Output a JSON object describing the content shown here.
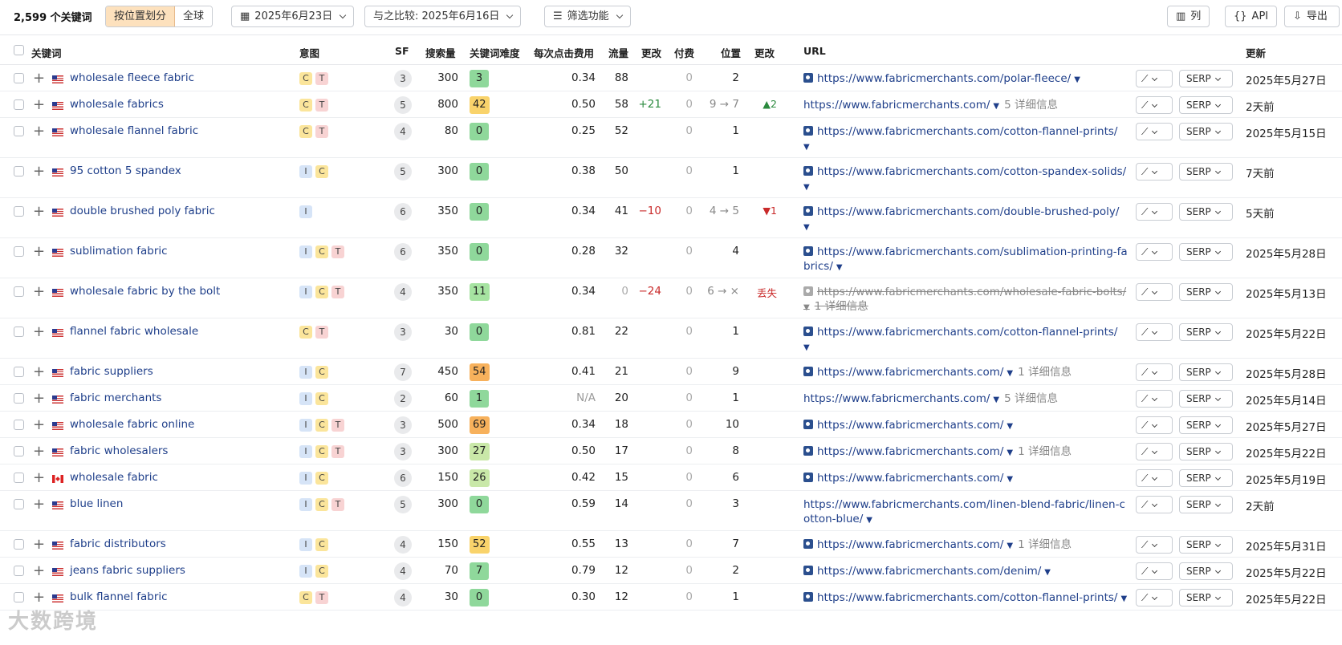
{
  "toolbar": {
    "count": "2,599 个关键词",
    "seg_by_position": "按位置划分",
    "seg_global": "全球",
    "date": "2025年6月23日",
    "compare": "与之比较:  2025年6月16日",
    "filters": "筛选功能",
    "view_list": "列",
    "api": "API",
    "export": "导出"
  },
  "columns": {
    "keyword": "关键词",
    "intent": "意图",
    "sf": "SF",
    "volume": "搜索量",
    "kd": "关键词难度",
    "cpc": "每次点击费用",
    "traffic": "流量",
    "change": "更改",
    "paid": "付费",
    "position": "位置",
    "pos_change": "更改",
    "url": "URL",
    "updated": "更新"
  },
  "colors": {
    "kd_green": "#a6e3a1",
    "kd_lightgreen": "#c9e8a8",
    "kd_yellow": "#f9d36b",
    "kd_orange": "#f7b15c",
    "up": "#2b8a3e",
    "down": "#c92a2a"
  },
  "rows": [
    {
      "kw": "wholesale fleece fabric",
      "flag": "us",
      "intents": [
        "C",
        "T"
      ],
      "sf": "3",
      "vol": "300",
      "kd": "3",
      "kdc": "#8fd89b",
      "cpc": "0.34",
      "tr": "88",
      "chg": "",
      "chgc": "",
      "paid": "0",
      "pos": "2",
      "pchg": "",
      "pchgc": "",
      "url1": "https://www.fabricmerchants.com/polar-fleece/",
      "url2": "",
      "det": "",
      "pic": true,
      "lost": false,
      "upd": "2025年5月27日",
      "h": 33
    },
    {
      "kw": "wholesale fabrics",
      "flag": "us",
      "intents": [
        "C",
        "T"
      ],
      "sf": "5",
      "vol": "800",
      "kd": "42",
      "kdc": "#f9d36b",
      "cpc": "0.50",
      "tr": "58",
      "chg": "+21",
      "chgc": "#2b8a3e",
      "paid": "0",
      "pos": "9 → 7",
      "pchg": "▲2",
      "pchgc": "#2b8a3e",
      "url1": "https://www.fabricmerchants.com/",
      "url2": "",
      "det": "5 详细信息",
      "pic": false,
      "lost": false,
      "upd": "2天前",
      "h": 33
    },
    {
      "kw": "wholesale flannel fabric",
      "flag": "us",
      "intents": [
        "C",
        "T"
      ],
      "sf": "4",
      "vol": "80",
      "kd": "0",
      "kdc": "#8fd89b",
      "cpc": "0.25",
      "tr": "52",
      "chg": "",
      "chgc": "",
      "paid": "0",
      "pos": "1",
      "pchg": "",
      "pchgc": "",
      "url1": "https://www.fabricmerchants.com/cotton-flannel-prints/",
      "url2": " ",
      "det": "",
      "pic": true,
      "lost": false,
      "upd": "2025年5月15日",
      "h": 50
    },
    {
      "kw": "95 cotton 5 spandex",
      "flag": "us",
      "intents": [
        "I",
        "C"
      ],
      "sf": "5",
      "vol": "300",
      "kd": "0",
      "kdc": "#8fd89b",
      "cpc": "0.38",
      "tr": "50",
      "chg": "",
      "chgc": "",
      "paid": "0",
      "pos": "1",
      "pchg": "",
      "pchgc": "",
      "url1": "https://www.fabricmerchants.com/cotton-spandex-solids/",
      "url2": " ",
      "det": "",
      "pic": true,
      "lost": false,
      "upd": "7天前",
      "h": 50
    },
    {
      "kw": "double brushed poly fabric",
      "flag": "us",
      "intents": [
        "I"
      ],
      "sf": "6",
      "vol": "350",
      "kd": "0",
      "kdc": "#8fd89b",
      "cpc": "0.34",
      "tr": "41",
      "chg": "−10",
      "chgc": "#c92a2a",
      "paid": "0",
      "pos": "4 → 5",
      "pchg": "▼1",
      "pchgc": "#c92a2a",
      "url1": "https://www.fabricmerchants.com/double-brushed-poly/",
      "url2": " ",
      "det": "",
      "pic": true,
      "lost": false,
      "upd": "5天前",
      "h": 50
    },
    {
      "kw": "sublimation fabric",
      "flag": "us",
      "intents": [
        "I",
        "C",
        "T"
      ],
      "sf": "6",
      "vol": "350",
      "kd": "0",
      "kdc": "#8fd89b",
      "cpc": "0.28",
      "tr": "32",
      "chg": "",
      "chgc": "",
      "paid": "0",
      "pos": "4",
      "pchg": "",
      "pchgc": "",
      "url1": "https://www.fabricmerchants.com/sublimation-printing-fa",
      "url2": "brics/",
      "det": "",
      "pic": true,
      "lost": false,
      "upd": "2025年5月28日",
      "h": 50
    },
    {
      "kw": "wholesale fabric by the bolt",
      "flag": "us",
      "intents": [
        "I",
        "C",
        "T"
      ],
      "sf": "4",
      "vol": "350",
      "kd": "11",
      "kdc": "#a6e3a1",
      "cpc": "0.34",
      "tr": "0",
      "chg": "−24",
      "chgc": "#c92a2a",
      "paid": "0",
      "pos": "6 → ×",
      "pchg": "丢失",
      "pchgc": "#c92a2a",
      "url1": "https://www.fabricmerchants.com/wholesale-fabric-bolts/",
      "url2": "1 详细信息",
      "det": "",
      "pic": true,
      "lost": true,
      "upd": "2025年5月13日",
      "h": 50
    },
    {
      "kw": "flannel fabric wholesale",
      "flag": "us",
      "intents": [
        "C",
        "T"
      ],
      "sf": "3",
      "vol": "30",
      "kd": "0",
      "kdc": "#8fd89b",
      "cpc": "0.81",
      "tr": "22",
      "chg": "",
      "chgc": "",
      "paid": "0",
      "pos": "1",
      "pchg": "",
      "pchgc": "",
      "url1": "https://www.fabricmerchants.com/cotton-flannel-prints/",
      "url2": " ",
      "det": "",
      "pic": true,
      "lost": false,
      "upd": "2025年5月22日",
      "h": 50
    },
    {
      "kw": "fabric suppliers",
      "flag": "us",
      "intents": [
        "I",
        "C"
      ],
      "sf": "7",
      "vol": "450",
      "kd": "54",
      "kdc": "#f7b15c",
      "cpc": "0.41",
      "tr": "21",
      "chg": "",
      "chgc": "",
      "paid": "0",
      "pos": "9",
      "pchg": "",
      "pchgc": "",
      "url1": "https://www.fabricmerchants.com/",
      "url2": "",
      "det": "1 详细信息",
      "pic": true,
      "lost": false,
      "upd": "2025年5月28日",
      "h": 33
    },
    {
      "kw": "fabric merchants",
      "flag": "us",
      "intents": [
        "I",
        "C"
      ],
      "sf": "2",
      "vol": "60",
      "kd": "1",
      "kdc": "#8fd89b",
      "cpc": "N/A",
      "tr": "20",
      "chg": "",
      "chgc": "",
      "paid": "0",
      "pos": "1",
      "pchg": "",
      "pchgc": "",
      "url1": "https://www.fabricmerchants.com/",
      "url2": "",
      "det": "5 详细信息",
      "pic": false,
      "lost": false,
      "upd": "2025年5月14日",
      "h": 33
    },
    {
      "kw": "wholesale fabric online",
      "flag": "us",
      "intents": [
        "I",
        "C",
        "T"
      ],
      "sf": "3",
      "vol": "500",
      "kd": "69",
      "kdc": "#f7b15c",
      "cpc": "0.34",
      "tr": "18",
      "chg": "",
      "chgc": "",
      "paid": "0",
      "pos": "10",
      "pchg": "",
      "pchgc": "",
      "url1": "https://www.fabricmerchants.com/",
      "url2": "",
      "det": "",
      "pic": true,
      "lost": false,
      "upd": "2025年5月27日",
      "h": 33
    },
    {
      "kw": "fabric wholesalers",
      "flag": "us",
      "intents": [
        "I",
        "C",
        "T"
      ],
      "sf": "3",
      "vol": "300",
      "kd": "27",
      "kdc": "#c9e8a8",
      "cpc": "0.50",
      "tr": "17",
      "chg": "",
      "chgc": "",
      "paid": "0",
      "pos": "8",
      "pchg": "",
      "pchgc": "",
      "url1": "https://www.fabricmerchants.com/",
      "url2": "",
      "det": "1 详细信息",
      "pic": true,
      "lost": false,
      "upd": "2025年5月22日",
      "h": 33
    },
    {
      "kw": "wholesale fabric",
      "flag": "ca",
      "intents": [
        "I",
        "C"
      ],
      "sf": "6",
      "vol": "150",
      "kd": "26",
      "kdc": "#c9e8a8",
      "cpc": "0.42",
      "tr": "15",
      "chg": "",
      "chgc": "",
      "paid": "0",
      "pos": "6",
      "pchg": "",
      "pchgc": "",
      "url1": "https://www.fabricmerchants.com/",
      "url2": "",
      "det": "",
      "pic": true,
      "lost": false,
      "upd": "2025年5月19日",
      "h": 33
    },
    {
      "kw": "blue linen",
      "flag": "us",
      "intents": [
        "I",
        "C",
        "T"
      ],
      "sf": "5",
      "vol": "300",
      "kd": "0",
      "kdc": "#8fd89b",
      "cpc": "0.59",
      "tr": "14",
      "chg": "",
      "chgc": "",
      "paid": "0",
      "pos": "3",
      "pchg": "",
      "pchgc": "",
      "url1": "https://www.fabricmerchants.com/linen-blend-fabric/linen-c",
      "url2": "otton-blue/",
      "det": "",
      "pic": false,
      "lost": false,
      "upd": "2天前",
      "h": 50
    },
    {
      "kw": "fabric distributors",
      "flag": "us",
      "intents": [
        "I",
        "C"
      ],
      "sf": "4",
      "vol": "150",
      "kd": "52",
      "kdc": "#f9d36b",
      "cpc": "0.55",
      "tr": "13",
      "chg": "",
      "chgc": "",
      "paid": "0",
      "pos": "7",
      "pchg": "",
      "pchgc": "",
      "url1": "https://www.fabricmerchants.com/",
      "url2": "",
      "det": "1 详细信息",
      "pic": true,
      "lost": false,
      "upd": "2025年5月31日",
      "h": 33
    },
    {
      "kw": "jeans fabric suppliers",
      "flag": "us",
      "intents": [
        "I",
        "C"
      ],
      "sf": "4",
      "vol": "70",
      "kd": "7",
      "kdc": "#8fd89b",
      "cpc": "0.79",
      "tr": "12",
      "chg": "",
      "chgc": "",
      "paid": "0",
      "pos": "2",
      "pchg": "",
      "pchgc": "",
      "url1": "https://www.fabricmerchants.com/denim/",
      "url2": "",
      "det": "",
      "pic": true,
      "lost": false,
      "upd": "2025年5月22日",
      "h": 33
    },
    {
      "kw": "bulk flannel fabric",
      "flag": "us",
      "intents": [
        "C",
        "T"
      ],
      "sf": "4",
      "vol": "30",
      "kd": "0",
      "kdc": "#8fd89b",
      "cpc": "0.30",
      "tr": "12",
      "chg": "",
      "chgc": "",
      "paid": "0",
      "pos": "1",
      "pchg": "",
      "pchgc": "",
      "url1": "https://www.fabricmerchants.com/cotton-flannel-prints/",
      "url2": "",
      "det": "",
      "pic": true,
      "lost": false,
      "upd": "2025年5月22日",
      "h": 33
    }
  ],
  "row_buttons": {
    "trend": "⟋",
    "serp": "SERP"
  },
  "watermark": "大数跨境"
}
